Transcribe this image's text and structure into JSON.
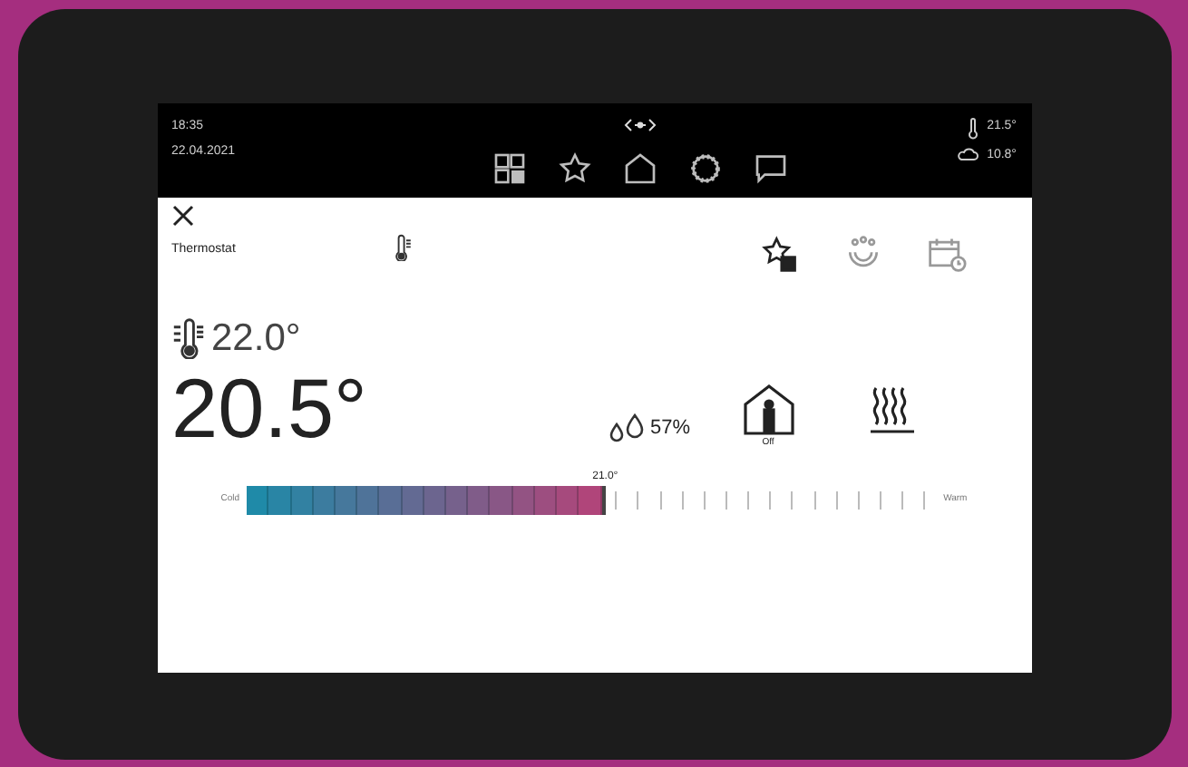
{
  "status_bar": {
    "time": "18:35",
    "date": "22.04.2021",
    "indoor_temp": "21.5°",
    "outdoor_temp": "10.8°",
    "nav": [
      {
        "kind": "rooms"
      },
      {
        "kind": "favorites"
      },
      {
        "kind": "home"
      },
      {
        "kind": "settings"
      },
      {
        "kind": "messages"
      }
    ]
  },
  "header": {
    "title": "Thermostat",
    "actions": [
      {
        "kind": "favorite-add"
      },
      {
        "kind": "presence"
      },
      {
        "kind": "schedule"
      }
    ]
  },
  "setpoint": "22.0°",
  "current": "20.5°",
  "humidity": "57%",
  "mode_label": "Off",
  "scale": {
    "cold_label": "Cold",
    "warm_label": "Warm",
    "value": "21.0°",
    "level": 0.52
  }
}
